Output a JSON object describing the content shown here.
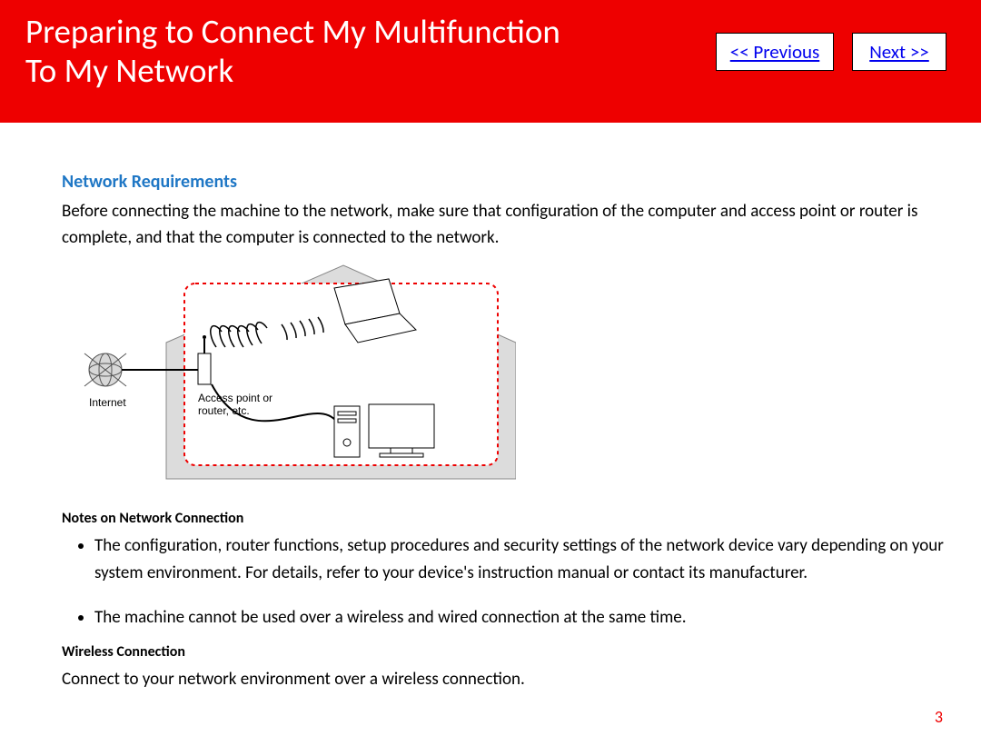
{
  "header": {
    "title_line1": "Preparing to Connect My Multifunction",
    "title_line2": "To My Network",
    "prev_label": "<< Previous",
    "next_label": "Next >>"
  },
  "body": {
    "section_heading": "Network Requirements",
    "intro": "Before connecting the machine to the network, make sure that configuration of the computer and access point or router is complete, and that the computer is connected to the network.",
    "notes_heading": "Notes on Network Connection",
    "note1": "The configuration, router functions, setup procedures and security settings of the network device vary depending on your system environment. For details, refer to your device's instruction manual or contact its manufacturer.",
    "note2": "The machine cannot be used over a wireless and wired connection at the same time.",
    "wireless_heading": "Wireless Connection",
    "wireless_body": "Connect to your network environment over a wireless connection."
  },
  "diagram_labels": {
    "internet": "Internet",
    "access_point": "Access point or",
    "access_point2": "router, etc."
  },
  "page_number": "3"
}
